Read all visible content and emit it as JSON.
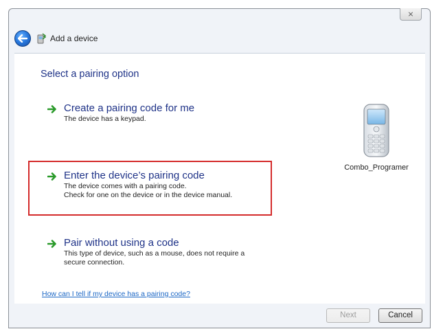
{
  "window": {
    "title": "Add a device",
    "close_glyph": "⨯"
  },
  "content": {
    "heading": "Select a pairing option",
    "options": [
      {
        "title": "Create a pairing code for me",
        "lines": [
          "The device has a keypad."
        ]
      },
      {
        "title": "Enter the device’s pairing code",
        "lines": [
          "The device comes with a pairing code.",
          "Check for one on the device or in the device manual."
        ]
      },
      {
        "title": "Pair without using a code",
        "lines": [
          "This type of device, such as a mouse, does not require a",
          "secure connection."
        ]
      }
    ],
    "help_link": "How can I tell if my device has a pairing code?"
  },
  "device": {
    "name": "Combo_Programer",
    "icon": "mobile-phone-icon"
  },
  "footer": {
    "next_label": "Next",
    "cancel_label": "Cancel"
  },
  "colors": {
    "accent": "#1e3287",
    "link": "#1a66c5",
    "highlight": "#d42a2a",
    "arrow": "#2a9a2a"
  }
}
